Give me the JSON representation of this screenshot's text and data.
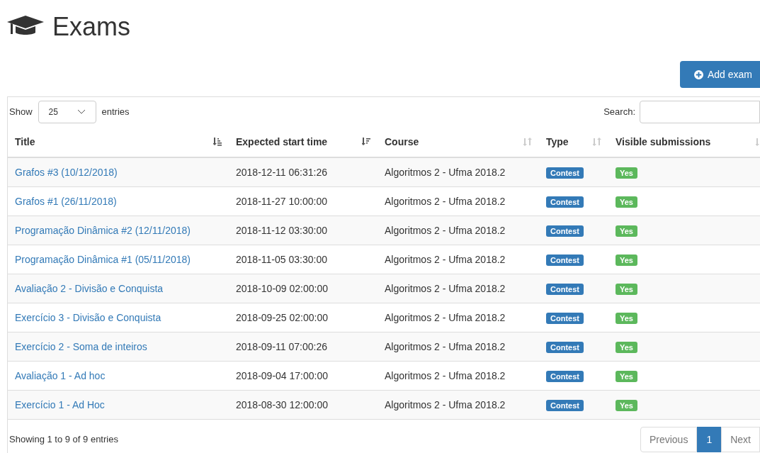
{
  "page_title": "Exams",
  "add_button": "Add exam",
  "length_control": {
    "before": "Show",
    "value": "25",
    "after": "entries"
  },
  "search": {
    "label": "Search:"
  },
  "columns": [
    {
      "label": "Title",
      "kind": "asc"
    },
    {
      "label": "Expected start time",
      "kind": "desc"
    },
    {
      "label": "Course",
      "kind": "unsorted"
    },
    {
      "label": "Type",
      "kind": "unsorted"
    },
    {
      "label": "Visible submissions",
      "kind": "unsorted"
    }
  ],
  "rows": [
    {
      "title": "Grafos #3 (10/12/2018)",
      "start": "2018-12-11 06:31:26",
      "course": "Algoritmos 2 - Ufma 2018.2",
      "type": "Contest",
      "visible": "Yes"
    },
    {
      "title": "Grafos #1 (26/11/2018)",
      "start": "2018-11-27 10:00:00",
      "course": "Algoritmos 2 - Ufma 2018.2",
      "type": "Contest",
      "visible": "Yes"
    },
    {
      "title": "Programação Dinâmica #2 (12/11/2018)",
      "start": "2018-11-12 03:30:00",
      "course": "Algoritmos 2 - Ufma 2018.2",
      "type": "Contest",
      "visible": "Yes"
    },
    {
      "title": "Programação Dinâmica #1 (05/11/2018)",
      "start": "2018-11-05 03:30:00",
      "course": "Algoritmos 2 - Ufma 2018.2",
      "type": "Contest",
      "visible": "Yes"
    },
    {
      "title": "Avaliação 2 - Divisão e Conquista",
      "start": "2018-10-09 02:00:00",
      "course": "Algoritmos 2 - Ufma 2018.2",
      "type": "Contest",
      "visible": "Yes"
    },
    {
      "title": "Exercício 3 - Divisão e Conquista",
      "start": "2018-09-25 02:00:00",
      "course": "Algoritmos 2 - Ufma 2018.2",
      "type": "Contest",
      "visible": "Yes"
    },
    {
      "title": "Exercício 2 - Soma de inteiros",
      "start": "2018-09-11 07:00:26",
      "course": "Algoritmos 2 - Ufma 2018.2",
      "type": "Contest",
      "visible": "Yes"
    },
    {
      "title": "Avaliação 1 - Ad hoc",
      "start": "2018-09-04 17:00:00",
      "course": "Algoritmos 2 - Ufma 2018.2",
      "type": "Contest",
      "visible": "Yes"
    },
    {
      "title": "Exercício 1 - Ad Hoc",
      "start": "2018-08-30 12:00:00",
      "course": "Algoritmos 2 - Ufma 2018.2",
      "type": "Contest",
      "visible": "Yes"
    }
  ],
  "info": "Showing 1 to 9 of 9 entries",
  "pagination": [
    {
      "label": "Previous",
      "selected": false
    },
    {
      "label": "1",
      "selected": true
    },
    {
      "label": "Next",
      "selected": false
    }
  ]
}
